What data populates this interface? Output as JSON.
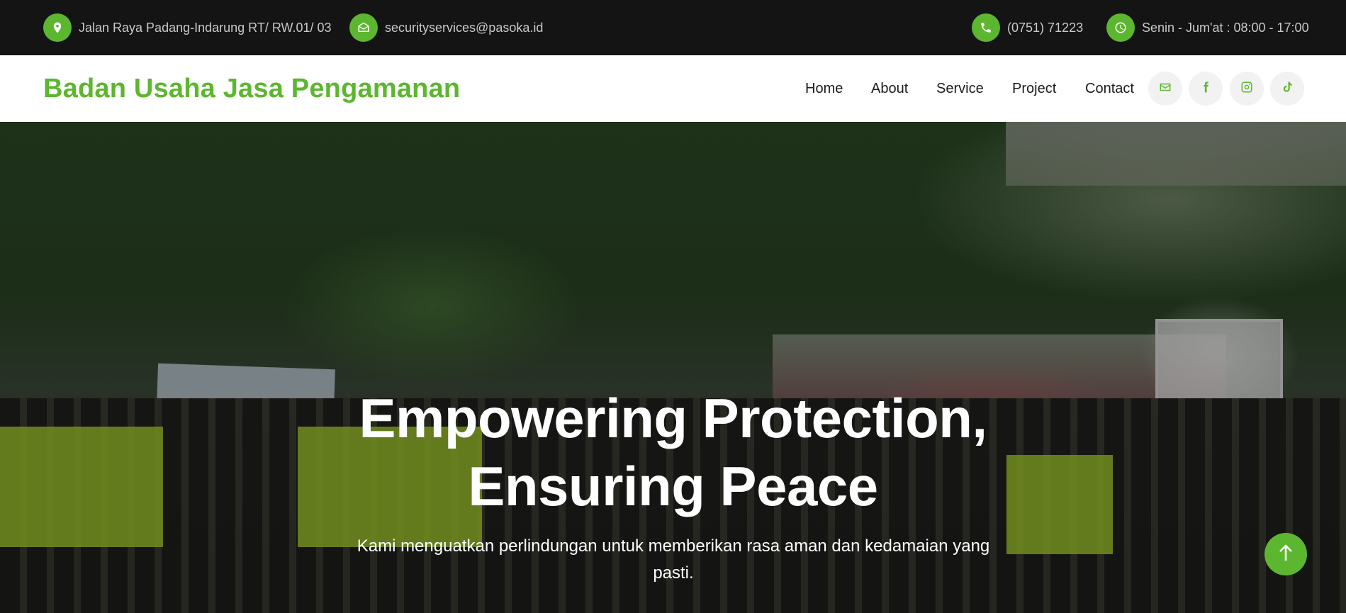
{
  "topbar": {
    "address": "Jalan Raya Padang-Indarung RT/ RW.01/ 03",
    "email": "securityservices@pasoka.id",
    "phone": "(0751) 71223",
    "hours": "Senin - Jum'at : 08:00 - 17:00"
  },
  "navbar": {
    "brand": "Badan Usaha Jasa Pengamanan",
    "links": [
      "Home",
      "About",
      "Service",
      "Project",
      "Contact"
    ],
    "social": [
      "envelope-icon",
      "facebook-icon",
      "instagram-icon",
      "tiktok-icon"
    ]
  },
  "hero": {
    "title_line1": "Empowering Protection,",
    "title_line2": "Ensuring Peace",
    "subtitle_line1": "Kami menguatkan perlindungan untuk memberikan rasa aman dan kedamaian yang",
    "subtitle_line2": "pasti."
  },
  "colors": {
    "accent": "#5db630",
    "topbar_bg": "#141414"
  },
  "icons": {
    "back_to_top": "arrow-up-icon"
  }
}
